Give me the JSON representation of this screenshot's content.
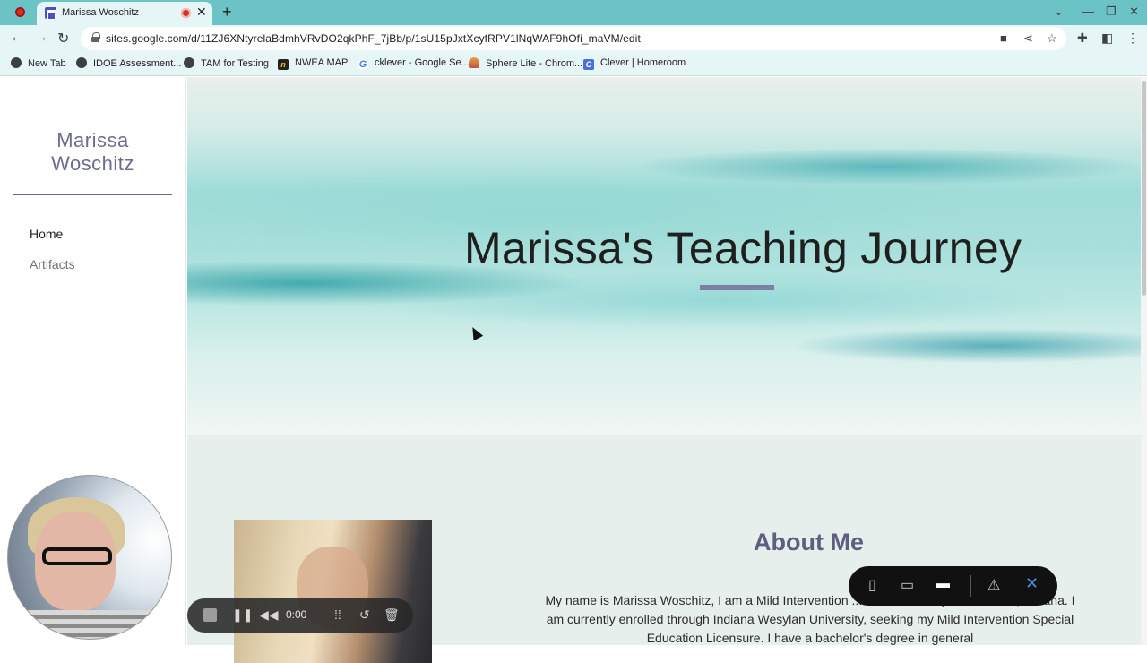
{
  "browser": {
    "tab": {
      "title": "Marissa Woschitz"
    },
    "url": "sites.google.com/d/11ZJ6XNtyrelaBdmhVRvDO2qkPhF_7jBb/p/1sU15pJxtXcyfRPV1lNqWAF9hOfi_maVM/edit",
    "bookmarks": [
      {
        "label": "New Tab",
        "icon": "globe-icon"
      },
      {
        "label": "IDOE Assessment...",
        "icon": "globe-icon"
      },
      {
        "label": "TAM for Testing",
        "icon": "globe-icon"
      },
      {
        "label": "NWEA MAP",
        "icon": "nwea-icon"
      },
      {
        "label": "cklever - Google Se...",
        "icon": "google-icon"
      },
      {
        "label": "Sphere Lite - Chrom...",
        "icon": "sphere-icon"
      },
      {
        "label": "Clever | Homeroom",
        "icon": "clever-icon"
      }
    ]
  },
  "site": {
    "name": "Marissa Woschitz",
    "nav": [
      {
        "label": "Home",
        "active": true
      },
      {
        "label": "Artifacts",
        "active": false
      }
    ],
    "hero_title": "Marissa's Teaching Journey",
    "about": {
      "title": "About Me",
      "text": "My name is Marissa Woschitz, I am a Mild Intervention ... de Elementary in Anderson, Indiana.  I am currently enrolled through Indiana Wesylan University, seeking my Mild Intervention Special Education Licensure.  I have a bachelor's degree in general"
    }
  },
  "recorder": {
    "time": "0:00"
  },
  "colors": {
    "accent": "#6b6d8e",
    "tabstrip": "#6cc3c6",
    "hero_bar": "#7c7fa6"
  }
}
